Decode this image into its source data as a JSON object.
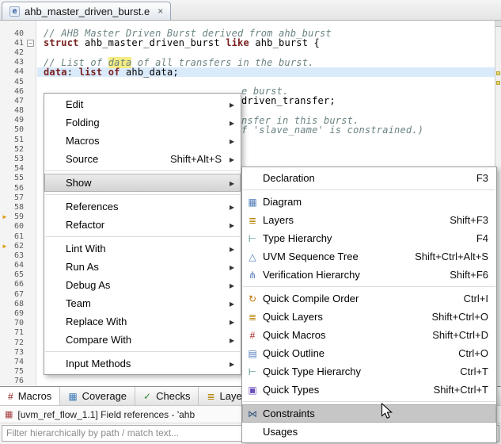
{
  "colors": {
    "keyword": "#7a2020",
    "comment": "#6b8383",
    "current_line_bg": "#d9eafb",
    "occurrence_bg": "#f5ec82",
    "line_number": "#5a5a5a",
    "menu_highlight": "#c6c6c6"
  },
  "ui": {
    "submenu_arrow": "▸",
    "fold_minus": "−",
    "occurrence_arrow": "►"
  },
  "editor_tab": {
    "title": "ahb_master_driven_burst.e",
    "close_icon": "×",
    "file_icon_glyph": "e"
  },
  "code": {
    "lines": [
      {
        "n": 40,
        "segs": [
          {
            "t": "// AHB Master Driven Burst derived from ahb_burst",
            "c": "comment"
          }
        ]
      },
      {
        "n": 41,
        "fold": true,
        "segs": [
          {
            "t": "struct",
            "c": "kw"
          },
          {
            "t": " ahb_master_driven_burst ",
            "c": "plain"
          },
          {
            "t": "like",
            "c": "kw"
          },
          {
            "t": " ahb_burst {",
            "c": "plain"
          }
        ]
      },
      {
        "n": 42
      },
      {
        "n": 43,
        "segs": [
          {
            "t": "// List of ",
            "c": "comment"
          },
          {
            "t": "data",
            "c": "comment occ"
          },
          {
            "t": " of all transfers in the burst.",
            "c": "comment"
          }
        ]
      },
      {
        "n": 44,
        "current": true,
        "segs": [
          {
            "t": "data",
            "c": "kw"
          },
          {
            "t": ": ",
            "c": "plain"
          },
          {
            "t": "list",
            "c": "kw"
          },
          {
            "t": " ",
            "c": "plain"
          },
          {
            "t": "of",
            "c": "kw"
          },
          {
            "t": " ahb_data;",
            "c": "plain"
          }
        ]
      },
      {
        "n": 45
      },
      {
        "n": 46,
        "pad": 250,
        "segs": [
          {
            "t": "e burst.",
            "c": "comment"
          }
        ]
      },
      {
        "n": 47,
        "pad": 250,
        "segs": [
          {
            "t": "driven_transfer;",
            "c": "plain"
          }
        ]
      },
      {
        "n": 48
      },
      {
        "n": 49,
        "pad": 250,
        "segs": [
          {
            "t": "nsfer in this burst.",
            "c": "comment"
          }
        ]
      },
      {
        "n": 50,
        "pad": 250,
        "segs": [
          {
            "t": "f 'slave_name' is constrained.)",
            "c": "comment"
          }
        ]
      },
      {
        "n": 51
      },
      {
        "n": 52
      },
      {
        "n": 53
      },
      {
        "n": 54
      },
      {
        "n": 55
      },
      {
        "n": 56
      },
      {
        "n": 57
      },
      {
        "n": 58
      },
      {
        "n": 59,
        "arrow": true
      },
      {
        "n": 60
      },
      {
        "n": 61
      },
      {
        "n": 62,
        "arrow": true
      },
      {
        "n": 63
      },
      {
        "n": 64
      },
      {
        "n": 65
      },
      {
        "n": 66
      },
      {
        "n": 67
      },
      {
        "n": 68
      },
      {
        "n": 69
      },
      {
        "n": 70
      },
      {
        "n": 71
      },
      {
        "n": 72
      },
      {
        "n": 73
      },
      {
        "n": 74
      },
      {
        "n": 75
      },
      {
        "n": 76
      }
    ]
  },
  "context_menu": {
    "items": [
      {
        "label": "Edit",
        "submenu": true
      },
      {
        "label": "Folding",
        "submenu": true
      },
      {
        "label": "Macros",
        "submenu": true
      },
      {
        "label": "Source",
        "shortcut": "Shift+Alt+S",
        "submenu": true
      },
      {
        "sep": true
      },
      {
        "label": "Show",
        "submenu": true,
        "highlight": true
      },
      {
        "sep": true
      },
      {
        "label": "References",
        "submenu": true
      },
      {
        "label": "Refactor",
        "submenu": true
      },
      {
        "sep": true
      },
      {
        "label": "Lint With",
        "submenu": true
      },
      {
        "label": "Run As",
        "submenu": true
      },
      {
        "label": "Debug As",
        "submenu": true
      },
      {
        "label": "Team",
        "submenu": true
      },
      {
        "label": "Replace With",
        "submenu": true
      },
      {
        "label": "Compare With",
        "submenu": true
      },
      {
        "sep": true
      },
      {
        "label": "Input Methods",
        "submenu": true
      }
    ]
  },
  "show_submenu": {
    "items": [
      {
        "label": "Declaration",
        "shortcut": "F3"
      },
      {
        "sep": true
      },
      {
        "label": "Diagram",
        "icon": "diagram-icon",
        "glyph": "▦",
        "icolor": "#4f7cba"
      },
      {
        "label": "Layers",
        "shortcut": "Shift+F3",
        "icon": "layers-icon",
        "glyph": "≣",
        "icolor": "#b8860b"
      },
      {
        "label": "Type Hierarchy",
        "shortcut": "F4",
        "icon": "type-hierarchy-icon",
        "glyph": "⊢",
        "icolor": "#2e7d72"
      },
      {
        "label": "UVM Sequence Tree",
        "shortcut": "Shift+Ctrl+Alt+S",
        "icon": "uvm-sequence-tree-icon",
        "glyph": "△",
        "icolor": "#4f7cba"
      },
      {
        "label": "Verification Hierarchy",
        "shortcut": "Shift+F6",
        "icon": "verification-hierarchy-icon",
        "glyph": "⋔",
        "icolor": "#4f7cba"
      },
      {
        "sep": true
      },
      {
        "label": "Quick Compile Order",
        "shortcut": "Ctrl+I",
        "icon": "quick-compile-order-icon",
        "glyph": "↻",
        "icolor": "#c07000"
      },
      {
        "label": "Quick Layers",
        "shortcut": "Shift+Ctrl+O",
        "icon": "quick-layers-icon",
        "glyph": "≣",
        "icolor": "#b8860b"
      },
      {
        "label": "Quick Macros",
        "shortcut": "Shift+Ctrl+D",
        "icon": "quick-macros-icon",
        "glyph": "#",
        "icolor": "#aa2222"
      },
      {
        "label": "Quick Outline",
        "shortcut": "Ctrl+O",
        "icon": "quick-outline-icon",
        "glyph": "▤",
        "icolor": "#4f7cba"
      },
      {
        "label": "Quick Type Hierarchy",
        "shortcut": "Ctrl+T",
        "icon": "quick-type-hierarchy-icon",
        "glyph": "⊢",
        "icolor": "#2e7d72"
      },
      {
        "label": "Quick Types",
        "shortcut": "Shift+Ctrl+T",
        "icon": "quick-types-icon",
        "glyph": "▣",
        "icolor": "#6a4fba"
      },
      {
        "sep": true
      },
      {
        "label": "Constraints",
        "icon": "constraints-icon",
        "glyph": "⋈",
        "icolor": "#33557f",
        "highlight": true
      },
      {
        "label": "Usages"
      }
    ]
  },
  "bottom_panel": {
    "tabs": [
      {
        "label": "Macros",
        "icon": "macros-icon",
        "glyph": "#",
        "icolor": "#8b1a1a",
        "active": true
      },
      {
        "label": "Coverage",
        "icon": "coverage-icon",
        "glyph": "▦",
        "icolor": "#3f7bb6"
      },
      {
        "label": "Checks",
        "icon": "checks-icon",
        "glyph": "✓",
        "icolor": "#2e8b2e"
      },
      {
        "label": "Laye",
        "icon": "layers-icon",
        "glyph": "≣",
        "icolor": "#b8860b"
      }
    ],
    "status_icon_glyph": "▦",
    "status_line": "[uvm_ref_flow_1.1] Field references - 'ahb",
    "filter_placeholder": "Filter hierarchically by path / match text..."
  }
}
